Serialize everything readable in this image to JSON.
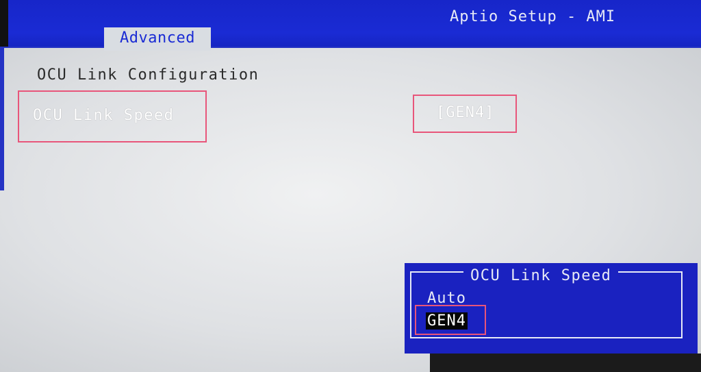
{
  "header": {
    "app_title": "Aptio Setup - AMI",
    "active_tab": "Advanced"
  },
  "main": {
    "section_title": "OCU Link Configuration",
    "setting": {
      "label": "OCU Link Speed",
      "value": "[GEN4]"
    }
  },
  "popup": {
    "title": "OCU Link Speed",
    "options": [
      "Auto",
      "GEN4"
    ],
    "selected": "GEN4"
  },
  "colors": {
    "header_blue": "#1a2bd4",
    "panel_gray": "#dfe1e4",
    "popup_blue": "#1a22c0",
    "highlight": "#e8557a",
    "selected_bg": "#050505"
  }
}
